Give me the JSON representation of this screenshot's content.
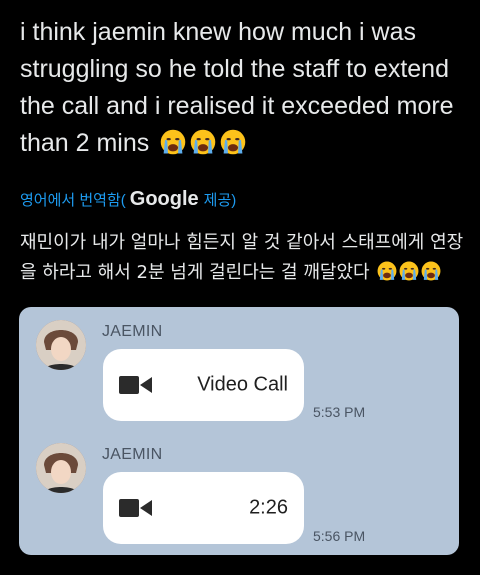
{
  "tweet": {
    "text": "i think jaemin knew how much i was struggling so he told the staff to extend the call and i realised it exceeded more than 2 mins",
    "emoji_icon": "loudly-crying-face-emoji",
    "emoji_count": 3
  },
  "translation": {
    "label": "영어에서 번역함(",
    "provider": "Google",
    "suffix": "제공)",
    "text": "재민이가 내가 얼마나 힘든지 알 것 같아서 스태프에게 연장을 하라고 해서 2분 넘게 걸린다는 걸 깨달았다"
  },
  "call_card": {
    "background": "#b4c5d8",
    "messages": [
      {
        "sender": "JAEMIN",
        "icon": "video-camera-icon",
        "text": "Video Call",
        "time": "5:53 PM"
      },
      {
        "sender": "JAEMIN",
        "icon": "video-camera-icon",
        "text": "2:26",
        "time": "5:56 PM"
      }
    ]
  },
  "colors": {
    "background": "#000000",
    "text": "#e7e9ea",
    "link": "#1d9bf0"
  }
}
